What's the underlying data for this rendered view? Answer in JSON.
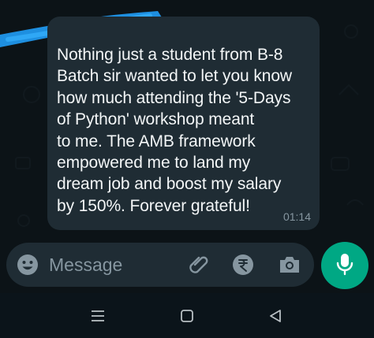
{
  "message": {
    "text": "Nothing just a student from B-8\nBatch sir wanted to let you know\nhow much attending the '5-Days\nof Python' workshop meant\nto me. The AMB framework\nempowered me to land my\ndream job and boost my salary\nby 150%. Forever grateful!",
    "time": "01:14"
  },
  "composer": {
    "placeholder": "Message",
    "icons": [
      "emoji-icon",
      "attach-icon",
      "rupee-payment-icon",
      "camera-icon"
    ]
  },
  "mic": {
    "icon": "mic-icon",
    "color": "#00a884"
  },
  "colors": {
    "chat_background": "#0c1317",
    "bubble": "#1f2c34",
    "accent": "#00a884",
    "redaction": "#1e8fe0"
  },
  "navbar": {
    "icons": [
      "recents-icon",
      "home-icon",
      "back-icon"
    ]
  }
}
